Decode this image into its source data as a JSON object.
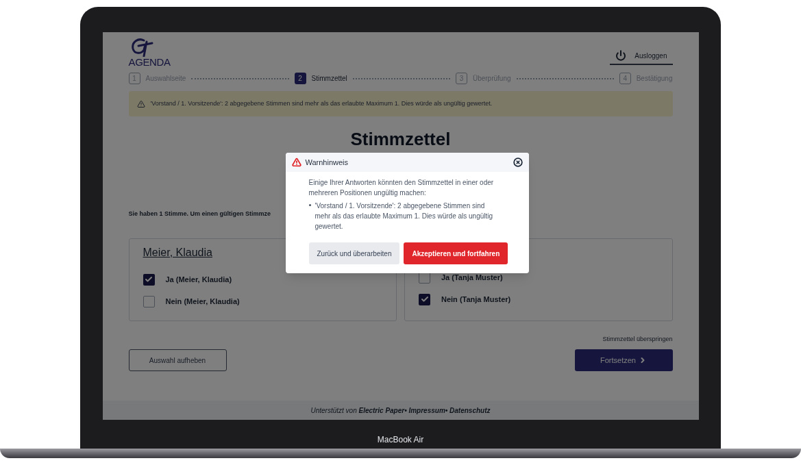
{
  "device": {
    "label": "MacBook Air"
  },
  "header": {
    "logo_text": "AGENDA",
    "logout": "Ausloggen"
  },
  "steps": [
    {
      "number": "1",
      "label": "Auswahlseite",
      "selected": false
    },
    {
      "number": "2",
      "label": "Stimmzettel",
      "selected": true
    },
    {
      "number": "3",
      "label": "Überprüfung",
      "selected": false
    },
    {
      "number": "4",
      "label": "Bestätigung",
      "selected": false
    }
  ],
  "alert": {
    "text": "'Vorstand / 1. Vorsitzende': 2 abgegebene Stimmen sind mehr als das erlaubte Maximum 1. Dies würde als ungültig gewertet."
  },
  "ballot": {
    "title": "Stimmzettel",
    "instruction": "Sie haben 1 Stimme. Um einen gültigen Stimmze",
    "candidates": [
      {
        "name": "Meier, Klaudia",
        "options": [
          {
            "label": "Ja (Meier, Klaudia)",
            "checked": true
          },
          {
            "label": "Nein (Meier, Klaudia)",
            "checked": false
          }
        ]
      },
      {
        "options": [
          {
            "label": "Ja (Tanja Muster)",
            "checked": false
          },
          {
            "label": "Nein (Tanja Muster)",
            "checked": true
          }
        ]
      }
    ]
  },
  "actions": {
    "clear": "Auswahl aufheben",
    "skip": "Stimmzettel überspringen",
    "continue": "Fortsetzen"
  },
  "footer": {
    "text": "Unterstützt von **Electric Paper• Impressum• Datenschutz**"
  },
  "dialog": {
    "title": "Warnhinweis",
    "intro": "Einige Ihrer Antworten könnten den Stimmzettel in einer oder mehreren Positionen ungültig machen:",
    "items": [
      "'Vorstand / 1. Vorsitzende': 2 abgegebene Stimmen sind mehr als das erlaubte Maximum 1. Dies würde als ungültig gewertet."
    ],
    "buttons": [
      {
        "label": "Zurück und überarbeiten",
        "kind": "secondary"
      },
      {
        "label": "Akzeptieren und fortfahren",
        "kind": "primary"
      }
    ]
  }
}
